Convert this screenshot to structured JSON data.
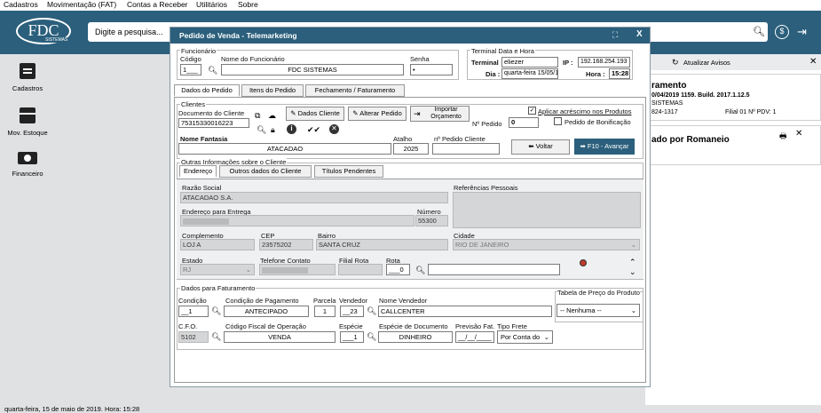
{
  "menu": [
    "Cadastros",
    "Movimentação (FAT)",
    "Contas a Receber",
    "Utilitários",
    "Sobre"
  ],
  "logo": {
    "text": "FDC",
    "sub": "SISTEMAS"
  },
  "search": {
    "placeholder": "Digite a pesquisa..."
  },
  "nav": [
    {
      "label": "Cadastros",
      "icon": "clipboard-icon"
    },
    {
      "label": "Mov. Estoque",
      "icon": "box-icon"
    },
    {
      "label": "Financeiro",
      "icon": "money-icon"
    }
  ],
  "right_panel": {
    "refresh_label": "Atualizar Avisos",
    "card1": {
      "title": "ramento",
      "line1": "0/04/2019 1159. Build. 2017.1.12.5",
      "line2": "SISTEMAS",
      "line3a": "824-1317",
      "line3b": "Filial 01  Nº PDV: 1"
    },
    "card2": {
      "title": "ado por Romaneio"
    }
  },
  "status_bar": "quarta-feira, 15 de maio de 2019. Hora: 15:28",
  "modal": {
    "title": "Pedido de Venda - Telemarketing",
    "funcionario": {
      "group": "Funcionário",
      "codigo_label": "Código",
      "codigo": "1___",
      "nome_label": "Nome do Funcionário",
      "nome": "FDC SISTEMAS",
      "senha_label": "Senha",
      "senha": "•"
    },
    "terminal": {
      "group": "Terminal Data e Hora",
      "terminal_label": "Terminal",
      "terminal": "eliezer",
      "ip_label": "IP :",
      "ip": "192.168.254.193",
      "dia_label": "Dia :",
      "dia": "quarta-feira 15/05/19",
      "hora_label": "Hora :",
      "hora": "15:28"
    },
    "tabs": [
      "Dados do Pedido",
      "Itens do Pedido",
      "Fechamento / Faturamento"
    ],
    "clientes": {
      "group": "Clientes",
      "doc_label": "Documento do Cliente",
      "doc": "75315330016223",
      "btn_dados": "Dados Cliente",
      "btn_alterar": "Alterar Pedido",
      "btn_importar": "Importar Orçamento",
      "aplicar_label": "Aplicar acréscimo nos Produtos",
      "aplicar_checked": "✓",
      "bonificacao_label": "Pedido de Bonificação",
      "num_pedido_label": "Nº Pedido",
      "num_pedido": "0",
      "fantasia_label": "Nome Fantasia",
      "fantasia": "ATACADAO",
      "atalho_label": "Atalho",
      "atalho": "2025",
      "ped_cliente_label": "nº Pedido Cliente",
      "btn_voltar": "Voltar",
      "btn_avancar": "F10 - Avançar"
    },
    "outras": {
      "group": "Outras Informações sobre o Cliente",
      "tabs": [
        "Endereço",
        "Outros dados do Cliente",
        "Títulos Pendentes"
      ],
      "razao_label": "Razão Social",
      "razao": "ATACADAO S.A.",
      "ref_label": "Referências Pessoais",
      "end_label": "Endereço para Entrega",
      "numero_label": "Número",
      "numero": "55300",
      "compl_label": "Complemento",
      "compl": "LOJ A",
      "cep_label": "CEP",
      "cep": "23575202",
      "bairro_label": "Bairro",
      "bairro": "SANTA CRUZ",
      "cidade_label": "Cidade",
      "cidade": "RIO DE JANEIRO",
      "estado_label": "Estado",
      "estado": "RJ",
      "tel_label": "Telefone Contato",
      "filial_rota_label": "Filial Rota",
      "rota_label": "Rota",
      "rota": "___0"
    },
    "faturamento": {
      "group": "Dados para Faturamento",
      "cond_label": "Condição",
      "cond": "__1",
      "cond_pag_label": "Condição de Pagamento",
      "cond_pag": "ANTECIPADO",
      "parcela_label": "Parcela",
      "parcela": "1",
      "vendedor_label": "Vendedor",
      "vendedor": "__23",
      "nome_vend_label": "Nome Vendedor",
      "nome_vend": "CALLCENTER",
      "tabela_label": "Tabela de Preço do Produto",
      "tabela": "-- Nenhuma --",
      "cfo_label": "C.F.O.",
      "cfo": "5102",
      "cod_fiscal_label": "Código Fiscal de Operação",
      "cod_fiscal": "VENDA",
      "especie_label": "Espécie",
      "especie": "___1",
      "esp_doc_label": "Espécie de Documento",
      "esp_doc": "DINHEIRO",
      "prev_label": "Previsão Fat.",
      "prev": "__/__/____",
      "frete_label": "Tipo Frete",
      "frete": "Por Conta do"
    }
  }
}
